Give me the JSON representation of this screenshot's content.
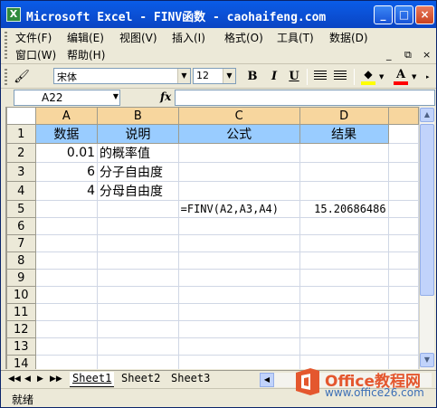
{
  "window": {
    "title": "Microsoft Excel - FINV函数 - caohaifeng.com",
    "app_icon": "X",
    "controls": {
      "minimize": "_",
      "maximize": "□",
      "close": "×"
    }
  },
  "menubar": {
    "items": [
      {
        "label": "文件(F)"
      },
      {
        "label": "编辑(E)"
      },
      {
        "label": "视图(V)"
      },
      {
        "label": "插入(I)"
      },
      {
        "label": "格式(O)"
      },
      {
        "label": "工具(T)"
      },
      {
        "label": "数据(D)"
      },
      {
        "label": "窗口(W)"
      },
      {
        "label": "帮助(H)"
      }
    ],
    "doc_controls": {
      "minimize": "_",
      "restore": "⧉",
      "close": "×"
    }
  },
  "toolbar": {
    "font_name": "宋体",
    "font_size": "12",
    "bold": "B",
    "italic": "I",
    "underline": "U",
    "fill_icon": "paint-bucket-icon",
    "font_color_letter": "A",
    "colors": {
      "fill": "#ffff00",
      "font": "#ff0000"
    }
  },
  "formula_bar": {
    "name_box": "A22",
    "fx": "fx",
    "formula": ""
  },
  "sheet": {
    "columns": [
      "A",
      "B",
      "C",
      "D"
    ],
    "row_numbers": [
      "1",
      "2",
      "3",
      "4",
      "5",
      "6",
      "7",
      "8",
      "9",
      "10",
      "11",
      "12",
      "13",
      "14"
    ],
    "rows": [
      [
        "数据",
        "说明",
        "公式",
        "结果"
      ],
      [
        "0.01",
        "的概率值",
        "",
        ""
      ],
      [
        "6",
        "分子自由度",
        "",
        ""
      ],
      [
        "4",
        "分母自由度",
        "",
        ""
      ],
      [
        "",
        "",
        "=FINV(A2,A3,A4)",
        "15.20686486"
      ]
    ],
    "header_color": "#99ccff",
    "column_header_color": "#f7d69e"
  },
  "tabs": {
    "nav": [
      "◀◀",
      "◀",
      "▶",
      "▶▶"
    ],
    "sheets": [
      "Sheet1",
      "Sheet2",
      "Sheet3"
    ]
  },
  "watermark": {
    "line1": "Office教程网",
    "line2": "www.office26.com"
  },
  "status": {
    "text": "就绪"
  }
}
